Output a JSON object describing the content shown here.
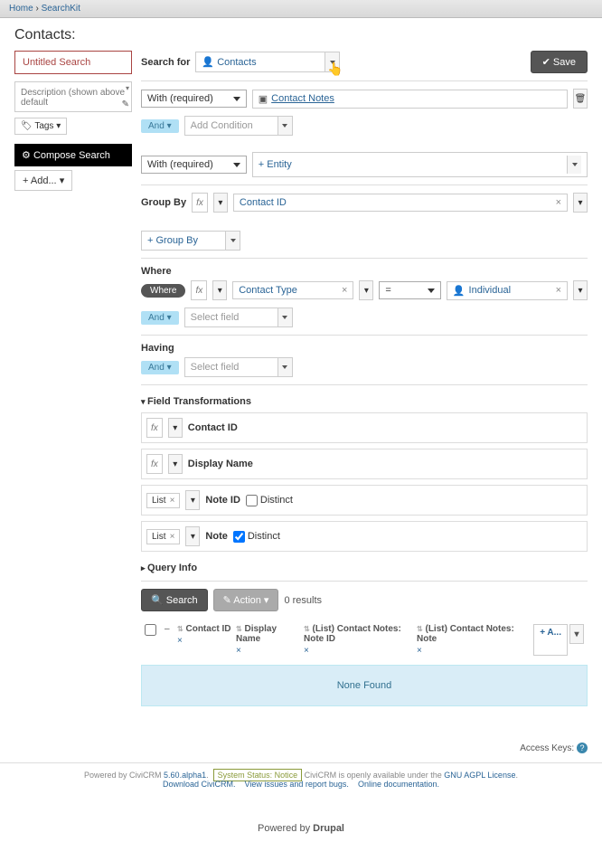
{
  "breadcrumb": {
    "home": "Home",
    "sep": " › ",
    "current": "SearchKit"
  },
  "page_title": "Contacts:",
  "sidebar": {
    "search_name": "Untitled Search",
    "description_placeholder": "Description (shown above default",
    "tags_label": "Tags",
    "compose_label": "Compose Search",
    "add_label": "+ Add..."
  },
  "search_for": {
    "label": "Search for",
    "entity": "Contacts"
  },
  "save_label": "Save",
  "join1": {
    "with": "With (required)",
    "entity": "Contact Notes",
    "and": "And",
    "add_condition_placeholder": "Add Condition"
  },
  "join2": {
    "with": "With (required)",
    "entity": "+ Entity"
  },
  "group_by": {
    "label": "Group By",
    "fx": "fx",
    "value": "Contact ID",
    "add": "+ Group By"
  },
  "where": {
    "label": "Where",
    "pill": "Where",
    "fx": "fx",
    "field": "Contact Type",
    "op": "=",
    "value": "Individual",
    "and": "And",
    "select_placeholder": "Select field"
  },
  "having": {
    "label": "Having",
    "and": "And",
    "select_placeholder": "Select field"
  },
  "field_transformations": {
    "title": "Field Transformations",
    "rows": [
      {
        "fx": "fx",
        "label": "Contact ID"
      },
      {
        "fx": "fx",
        "label": "Display Name"
      },
      {
        "list": "List",
        "label": "Note ID",
        "distinct": false
      },
      {
        "list": "List",
        "label": "Note",
        "distinct": true
      }
    ],
    "distinct_label": "Distinct"
  },
  "query_info": {
    "title": "Query Info"
  },
  "results": {
    "search_btn": "Search",
    "action_btn": "Action",
    "count": "0 results",
    "columns": [
      "Contact ID",
      "Display Name",
      "(List) Contact Notes: Note ID",
      "(List) Contact Notes: Note"
    ],
    "add_col": "+ A...",
    "none_found": "None Found"
  },
  "access_keys": "Access Keys:",
  "footer": {
    "text1": "Powered by CiviCRM ",
    "version": "5.60.alpha1",
    "status": "System Status: Notice",
    "text2": " CiviCRM is openly available under the ",
    "license": "GNU AGPL License",
    "download": "Download CiviCRM.",
    "issues": "View issues and report bugs.",
    "docs": "Online documentation."
  },
  "powered_by": "Powered by ",
  "drupal": "Drupal"
}
